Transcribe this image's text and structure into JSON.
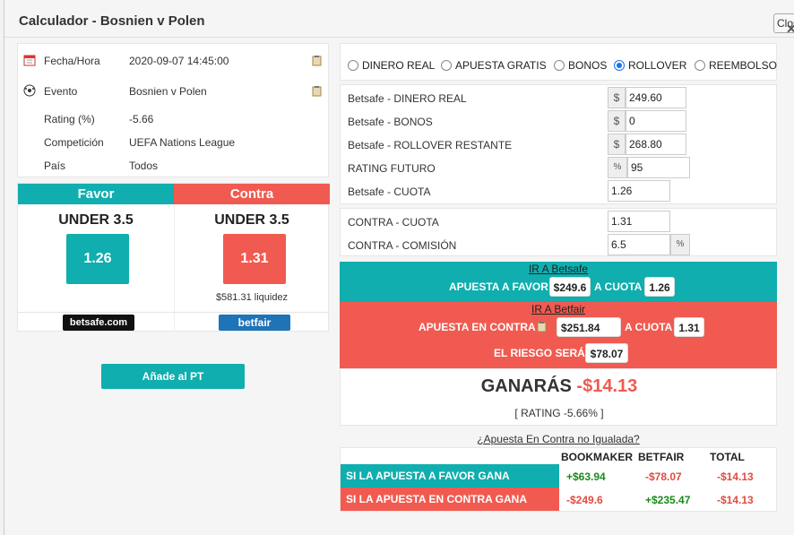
{
  "modal": {
    "title": "Calculador - Bosnien v Polen",
    "close_label": "Close"
  },
  "info": {
    "rows": [
      {
        "label": "Fecha/Hora",
        "value": "2020-09-07 14:45:00"
      },
      {
        "label": "Evento",
        "value": "Bosnien v Polen"
      },
      {
        "label": "Rating (%)",
        "value": "-5.66"
      },
      {
        "label": "Competición",
        "value": "UEFA Nations League"
      },
      {
        "label": "País",
        "value": "Todos"
      }
    ]
  },
  "favor": {
    "header": "Favor",
    "selection": "UNDER 3.5",
    "odds": "1.26",
    "bookmaker_logo": "betsafe.com"
  },
  "contra": {
    "header": "Contra",
    "selection": "UNDER 3.5",
    "odds": "1.31",
    "liquidity": "$581.31 liquidez",
    "exchange_logo": "betfair"
  },
  "add_pt_label": "Añade al PT",
  "bonus_types": [
    {
      "label": "DINERO REAL",
      "selected": false
    },
    {
      "label": "APUESTA GRATIS",
      "selected": false
    },
    {
      "label": "BONOS",
      "selected": false
    },
    {
      "label": "ROLLOVER",
      "selected": true
    },
    {
      "label": "REEMBOLSO",
      "selected": false
    }
  ],
  "fields": {
    "dinero_real": {
      "label": "Betsafe - DINERO REAL",
      "prefix": "$",
      "value": "249.60"
    },
    "bonos": {
      "label": "Betsafe - BONOS",
      "prefix": "$",
      "value": "0"
    },
    "rollover": {
      "label": "Betsafe - ROLLOVER RESTANTE",
      "prefix": "$",
      "value": "268.80"
    },
    "rating_futuro": {
      "label": "RATING FUTURO",
      "prefix": "%",
      "value": "95"
    },
    "cuota": {
      "label": "Betsafe - CUOTA",
      "value": "1.26"
    },
    "contra_cuota": {
      "label": "CONTRA - CUOTA",
      "value": "1.31"
    },
    "contra_comision": {
      "label": "CONTRA - COMISIÓN",
      "value": "6.5",
      "suffix": "%"
    }
  },
  "bet_favor": {
    "link": "IR A Betsafe",
    "text": "APUESTA A FAVOR",
    "amount": "$249.6",
    "odds_text": "A CUOTA",
    "odds": "1.26"
  },
  "bet_contra": {
    "link": "IR A Betfair",
    "text": "APUESTA EN CONTRA",
    "amount": "$251.84",
    "odds_text": "A CUOTA",
    "odds": "1.31",
    "risk_text": "EL RIESGO SERÁ",
    "risk": "$78.07"
  },
  "result": {
    "label": "GANARÁS",
    "amount": "-$14.13",
    "rating": "[ RATING -5.66% ]"
  },
  "unmatched_link": "¿Apuesta En Contra no Igualada?",
  "table": {
    "headers": [
      "BOOKMAKER",
      "BETFAIR",
      "TOTAL"
    ],
    "rows": [
      {
        "label": "SI LA APUESTA A FAVOR GANA",
        "bookmaker": "+$63.94",
        "betfair": "-$78.07",
        "total": "-$14.13"
      },
      {
        "label": "SI LA APUESTA EN CONTRA GANA",
        "bookmaker": "-$249.6",
        "betfair": "+$235.47",
        "total": "-$14.13"
      }
    ]
  },
  "colors": {
    "teal": "#10aeae",
    "red": "#f15a50",
    "positive": "#1a8a1a",
    "negative": "#e04b40"
  },
  "icons": [
    "calendar-icon",
    "soccer-ball-icon",
    "clipboard-icon",
    "copy-icon"
  ]
}
